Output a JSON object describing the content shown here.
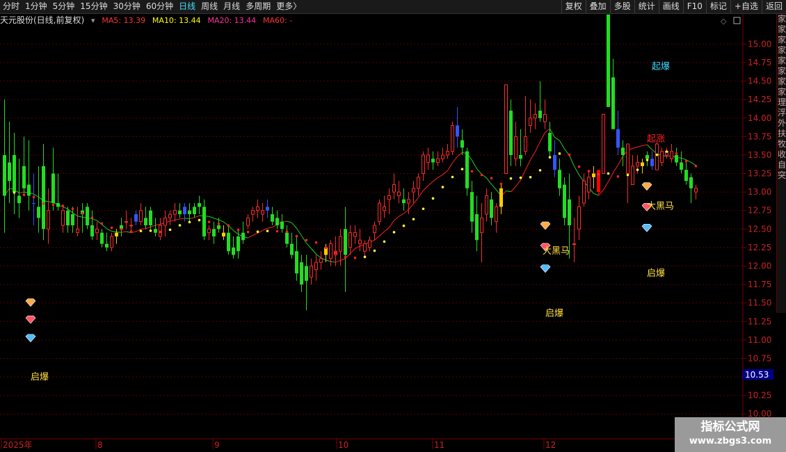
{
  "toolbar": {
    "periods": [
      "分时",
      "1分钟",
      "5分钟",
      "15分钟",
      "30分钟",
      "60分钟",
      "日线",
      "周线",
      "月线",
      "多周期",
      "更多"
    ],
    "active_period": "日线",
    "more_arrow": "〉",
    "tools": [
      "复权",
      "叠加",
      "多股",
      "统计",
      "画线",
      "F10",
      "标记",
      "+自选",
      "返回"
    ]
  },
  "infobar": {
    "title": "天元股份(日线,前复权)",
    "ma5": "MA5: 13.39",
    "ma10": "MA10: 13.44",
    "ma20": "MA20: 13.44",
    "ma60": "MA60: -",
    "colors": {
      "ma5": "#ff3333",
      "ma10": "#ffff00",
      "ma20": "#ff3399",
      "ma60": "#ff3333"
    }
  },
  "axis": {
    "y_ticks": [
      "15.00",
      "14.75",
      "14.50",
      "14.25",
      "14.00",
      "13.75",
      "13.50",
      "13.25",
      "13.00",
      "12.75",
      "12.50",
      "12.25",
      "12.00",
      "11.75",
      "11.50",
      "11.25",
      "11.00",
      "10.75",
      "10.50",
      "10.25",
      "10.00"
    ],
    "current_label": "10.53",
    "x_labels": [
      "2025年",
      "8",
      "9",
      "10",
      "11",
      "12"
    ]
  },
  "annotations": [
    {
      "text": "起爆",
      "color": "#40d8ff",
      "price": 14.7
    },
    {
      "text": "起涨",
      "color": "#ff2020",
      "price": 13.72
    },
    {
      "text": "大黑马",
      "color": "#ffe040",
      "price": 12.81
    },
    {
      "text": "大黑马",
      "color": "#ffe040",
      "price": 12.2
    },
    {
      "text": "启爆",
      "color": "#ffe040",
      "price": 11.9
    },
    {
      "text": "启爆",
      "color": "#ffe040",
      "price": 11.36
    },
    {
      "text": "启爆",
      "color": "#ffe040",
      "price": 10.5
    }
  ],
  "right_panel": {
    "chars": [
      "家",
      "家",
      "家",
      "家",
      "家",
      "家",
      "家",
      "家",
      "理",
      "浮",
      "外",
      "扶",
      "牧",
      "收",
      "自",
      "突"
    ]
  },
  "watermark": {
    "title": "指标公式网",
    "url": "www.zbgs3.com"
  },
  "chart_data": {
    "type": "candlestick",
    "title": "天元股份(日线,前复权)",
    "ylim": [
      9.88,
      15.22
    ],
    "ohlc": [
      [
        13.5,
        14.25,
        12.45,
        12.95
      ],
      [
        13.4,
        13.95,
        12.85,
        13.15
      ],
      [
        13.5,
        13.8,
        12.7,
        13.0
      ],
      [
        12.95,
        13.45,
        12.65,
        12.85
      ],
      [
        13.35,
        13.75,
        12.95,
        13.05
      ],
      [
        13.1,
        13.7,
        12.75,
        12.95
      ],
      [
        12.85,
        13.25,
        12.55,
        12.85
      ],
      [
        12.8,
        13.35,
        12.45,
        12.65
      ],
      [
        13.35,
        13.65,
        12.35,
        12.5
      ],
      [
        12.5,
        13.05,
        12.3,
        12.75
      ],
      [
        13.25,
        13.6,
        12.75,
        12.85
      ],
      [
        12.85,
        13.25,
        12.75,
        12.8
      ],
      [
        12.55,
        12.8,
        12.45,
        12.75
      ],
      [
        12.75,
        12.8,
        12.45,
        12.55
      ],
      [
        12.7,
        12.8,
        12.45,
        12.55
      ],
      [
        12.45,
        12.8,
        12.4,
        12.5
      ],
      [
        12.75,
        12.85,
        12.45,
        12.7
      ],
      [
        12.8,
        12.85,
        12.5,
        12.55
      ],
      [
        12.55,
        12.75,
        12.35,
        12.4
      ],
      [
        12.45,
        12.6,
        12.35,
        12.5
      ],
      [
        12.45,
        12.5,
        12.25,
        12.3
      ],
      [
        12.3,
        12.45,
        12.2,
        12.25
      ],
      [
        12.25,
        12.45,
        12.2,
        12.4
      ],
      [
        12.4,
        12.5,
        12.3,
        12.45
      ],
      [
        12.55,
        12.65,
        12.4,
        12.5
      ],
      [
        12.6,
        12.75,
        12.5,
        12.6
      ],
      [
        12.55,
        12.65,
        12.45,
        12.55
      ],
      [
        12.6,
        12.75,
        12.55,
        12.7
      ],
      [
        12.6,
        12.85,
        12.55,
        12.75
      ],
      [
        12.65,
        12.8,
        12.5,
        12.55
      ],
      [
        12.75,
        12.8,
        12.5,
        12.55
      ],
      [
        12.5,
        12.65,
        12.4,
        12.45
      ],
      [
        12.4,
        12.65,
        12.35,
        12.55
      ],
      [
        12.55,
        12.75,
        12.4,
        12.65
      ],
      [
        12.65,
        12.75,
        12.55,
        12.7
      ],
      [
        12.7,
        12.85,
        12.6,
        12.75
      ],
      [
        12.75,
        12.85,
        12.65,
        12.7
      ],
      [
        12.7,
        12.85,
        12.6,
        12.8
      ],
      [
        12.75,
        12.85,
        12.6,
        12.7
      ],
      [
        12.8,
        12.85,
        12.65,
        12.7
      ],
      [
        12.85,
        12.95,
        12.7,
        12.8
      ],
      [
        12.8,
        12.9,
        12.35,
        12.4
      ],
      [
        12.45,
        12.55,
        12.35,
        12.5
      ],
      [
        12.5,
        12.6,
        12.3,
        12.4
      ],
      [
        12.55,
        12.65,
        12.45,
        12.5
      ],
      [
        12.4,
        12.55,
        12.35,
        12.45
      ],
      [
        12.45,
        12.55,
        12.15,
        12.2
      ],
      [
        12.25,
        12.4,
        12.1,
        12.15
      ],
      [
        12.4,
        12.5,
        12.1,
        12.2
      ],
      [
        12.45,
        12.6,
        12.3,
        12.35
      ],
      [
        12.55,
        12.7,
        12.5,
        12.65
      ],
      [
        12.7,
        12.8,
        12.6,
        12.75
      ],
      [
        12.75,
        12.9,
        12.65,
        12.8
      ],
      [
        12.7,
        12.85,
        12.6,
        12.75
      ],
      [
        12.75,
        12.9,
        12.65,
        12.8
      ],
      [
        12.7,
        12.8,
        12.55,
        12.6
      ],
      [
        12.65,
        12.75,
        12.5,
        12.55
      ],
      [
        12.6,
        12.7,
        12.45,
        12.5
      ],
      [
        12.45,
        12.55,
        12.25,
        12.3
      ],
      [
        12.3,
        12.45,
        12.1,
        12.15
      ],
      [
        12.2,
        12.4,
        11.8,
        11.9
      ],
      [
        12.05,
        12.15,
        11.65,
        11.75
      ],
      [
        12.0,
        12.15,
        11.4,
        11.8
      ],
      [
        11.85,
        12.1,
        11.75,
        12.0
      ],
      [
        11.95,
        12.15,
        11.8,
        12.05
      ],
      [
        12.05,
        12.2,
        11.95,
        12.1
      ],
      [
        12.15,
        12.3,
        12.05,
        12.25
      ],
      [
        12.1,
        12.35,
        12.0,
        12.3
      ],
      [
        12.15,
        12.4,
        12.0,
        12.2
      ],
      [
        12.2,
        12.5,
        12.0,
        12.4
      ],
      [
        12.5,
        12.8,
        11.65,
        12.15
      ],
      [
        12.25,
        12.55,
        12.15,
        12.45
      ],
      [
        12.4,
        12.55,
        12.3,
        12.45
      ],
      [
        12.3,
        12.5,
        12.2,
        12.35
      ],
      [
        12.2,
        12.35,
        12.1,
        12.3
      ],
      [
        12.25,
        12.4,
        12.2,
        12.35
      ],
      [
        12.45,
        12.6,
        12.35,
        12.55
      ],
      [
        12.6,
        12.9,
        12.55,
        12.85
      ],
      [
        12.75,
        12.95,
        12.65,
        12.8
      ],
      [
        12.9,
        13.05,
        12.7,
        12.95
      ],
      [
        13.0,
        13.25,
        12.9,
        13.1
      ],
      [
        12.95,
        13.15,
        12.85,
        13.0
      ],
      [
        12.9,
        13.05,
        12.75,
        12.85
      ],
      [
        12.85,
        13.0,
        12.7,
        12.9
      ],
      [
        13.0,
        13.15,
        12.85,
        13.05
      ],
      [
        13.05,
        13.25,
        12.95,
        13.2
      ],
      [
        13.25,
        13.55,
        13.15,
        13.5
      ],
      [
        13.4,
        13.6,
        13.3,
        13.5
      ],
      [
        13.45,
        13.55,
        13.3,
        13.4
      ],
      [
        13.4,
        13.55,
        13.35,
        13.45
      ],
      [
        13.45,
        13.6,
        13.4,
        13.5
      ],
      [
        13.5,
        13.65,
        13.45,
        13.55
      ],
      [
        13.55,
        13.95,
        13.5,
        13.9
      ],
      [
        13.9,
        14.15,
        13.6,
        13.75
      ],
      [
        13.7,
        13.85,
        13.5,
        13.6
      ],
      [
        13.55,
        13.6,
        12.95,
        13.05
      ],
      [
        13.0,
        13.15,
        12.45,
        12.6
      ],
      [
        12.7,
        12.95,
        12.2,
        12.35
      ],
      [
        12.45,
        12.85,
        12.05,
        12.65
      ],
      [
        12.7,
        13.05,
        12.6,
        12.95
      ],
      [
        12.9,
        13.0,
        12.55,
        12.65
      ],
      [
        12.6,
        12.85,
        12.45,
        12.8
      ],
      [
        12.8,
        13.1,
        12.7,
        13.05
      ],
      [
        13.25,
        14.45,
        13.25,
        14.45
      ],
      [
        14.1,
        14.25,
        13.35,
        13.5
      ],
      [
        13.45,
        13.95,
        13.35,
        13.75
      ],
      [
        13.5,
        13.85,
        13.35,
        13.45
      ],
      [
        13.55,
        14.3,
        13.5,
        13.75
      ],
      [
        13.9,
        14.25,
        13.8,
        14.0
      ],
      [
        14.0,
        14.2,
        13.85,
        14.05
      ],
      [
        14.1,
        14.5,
        13.95,
        14.0
      ],
      [
        13.95,
        14.25,
        13.85,
        14.05
      ],
      [
        13.8,
        13.95,
        13.45,
        13.55
      ],
      [
        13.5,
        13.7,
        13.2,
        13.3
      ],
      [
        13.3,
        13.45,
        12.95,
        13.05
      ],
      [
        13.1,
        13.2,
        12.55,
        12.65
      ],
      [
        12.9,
        13.25,
        12.1,
        12.55
      ],
      [
        12.3,
        12.65,
        12.05,
        12.3
      ],
      [
        12.5,
        12.95,
        12.35,
        12.8
      ],
      [
        12.85,
        13.25,
        12.8,
        13.15
      ],
      [
        13.0,
        13.3,
        12.9,
        13.2
      ],
      [
        13.2,
        13.35,
        13.05,
        13.25
      ],
      [
        13.0,
        13.3,
        12.95,
        13.3
      ],
      [
        13.25,
        14.05,
        13.25,
        14.05
      ],
      [
        15.4,
        15.4,
        14.15,
        14.15
      ],
      [
        14.55,
        14.8,
        13.85,
        13.85
      ],
      [
        13.85,
        14.1,
        13.5,
        13.6
      ],
      [
        13.6,
        13.7,
        13.35,
        13.5
      ],
      [
        13.25,
        13.6,
        12.85,
        13.65
      ],
      [
        13.1,
        13.5,
        13.1,
        13.35
      ],
      [
        13.35,
        13.5,
        13.25,
        13.4
      ],
      [
        13.35,
        13.45,
        13.25,
        13.4
      ],
      [
        13.5,
        13.55,
        13.35,
        13.45
      ],
      [
        13.45,
        13.55,
        13.3,
        13.35
      ],
      [
        13.3,
        13.7,
        13.3,
        13.65
      ],
      [
        13.4,
        13.6,
        13.35,
        13.55
      ],
      [
        13.5,
        13.6,
        13.45,
        13.55
      ],
      [
        13.45,
        13.65,
        13.4,
        13.55
      ],
      [
        13.5,
        13.6,
        13.35,
        13.4
      ],
      [
        13.4,
        13.55,
        13.25,
        13.3
      ],
      [
        13.3,
        13.4,
        13.1,
        13.15
      ],
      [
        13.2,
        13.25,
        12.85,
        13.05
      ],
      [
        13.0,
        13.1,
        12.9,
        13.05
      ]
    ],
    "highlights": [
      {
        "index": 6,
        "color": "#3355ff"
      },
      {
        "index": 23,
        "color": "#ffcc00"
      },
      {
        "index": 27,
        "color": "#3355ff"
      },
      {
        "index": 37,
        "color": "#3355ff"
      },
      {
        "index": 45,
        "color": "#ffcc00"
      },
      {
        "index": 54,
        "color": "#3355ff"
      },
      {
        "index": 66,
        "color": "#ffcc00"
      },
      {
        "index": 93,
        "color": "#3355ff"
      },
      {
        "index": 102,
        "color": "#ffcc00"
      },
      {
        "index": 113,
        "color": "#3355ff"
      },
      {
        "index": 121,
        "color": "#ffcc00"
      },
      {
        "index": 122,
        "color": "#ff0000"
      },
      {
        "index": 126,
        "color": "#3355ff"
      },
      {
        "index": 131,
        "color": "#ffcc00"
      },
      {
        "index": 133,
        "color": "#3355ff"
      }
    ]
  }
}
